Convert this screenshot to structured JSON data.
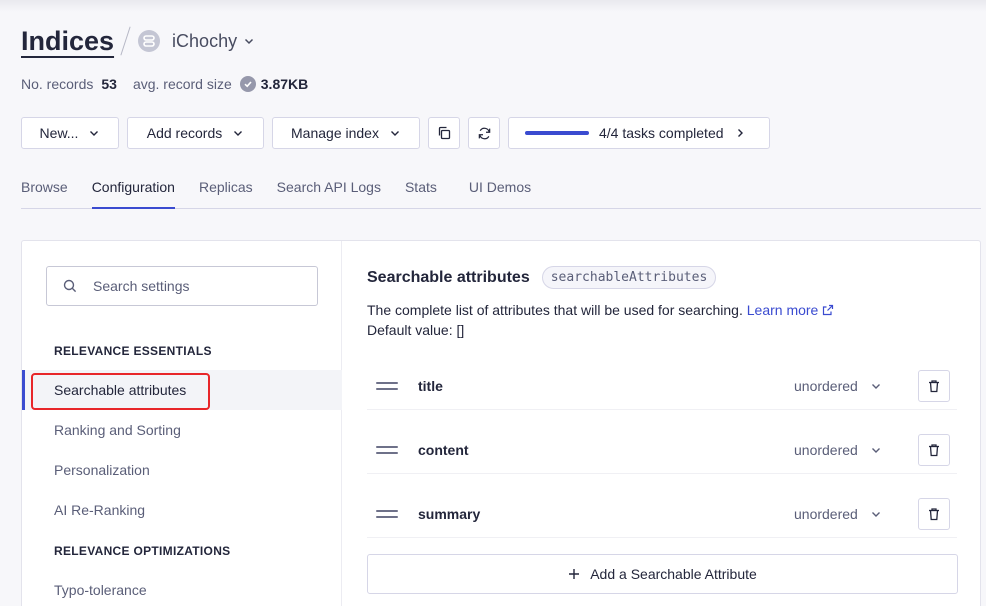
{
  "header": {
    "title": "Indices",
    "app_name": "iChochy"
  },
  "stats": {
    "records_label": "No. records",
    "records_value": "53",
    "avg_label": "avg. record size",
    "avg_value": "3.87KB"
  },
  "toolbar": {
    "new_label": "New...",
    "add_records_label": "Add records",
    "manage_index_label": "Manage index",
    "tasks_label": "4/4 tasks completed",
    "tasks_progress": 1.0
  },
  "tabs": [
    "Browse",
    "Configuration",
    "Replicas",
    "Search API Logs",
    "Stats",
    "UI Demos"
  ],
  "active_tab": "Configuration",
  "sidebar": {
    "search_placeholder": "Search settings",
    "section1": "RELEVANCE ESSENTIALS",
    "items1": [
      "Searchable attributes",
      "Ranking and Sorting",
      "Personalization",
      "AI Re-Ranking"
    ],
    "section2": "RELEVANCE OPTIMIZATIONS",
    "items2": [
      "Typo-tolerance"
    ]
  },
  "content": {
    "title": "Searchable attributes",
    "code": "searchableAttributes",
    "description": "The complete list of attributes that will be used for searching.",
    "learn_more": "Learn more",
    "default_value": "Default value: []",
    "attributes": [
      {
        "name": "title",
        "order": "unordered"
      },
      {
        "name": "content",
        "order": "unordered"
      },
      {
        "name": "summary",
        "order": "unordered"
      }
    ],
    "add_label": "Add a Searchable Attribute"
  },
  "colors": {
    "accent": "#3a4bd0",
    "highlight": "#e8262a"
  }
}
